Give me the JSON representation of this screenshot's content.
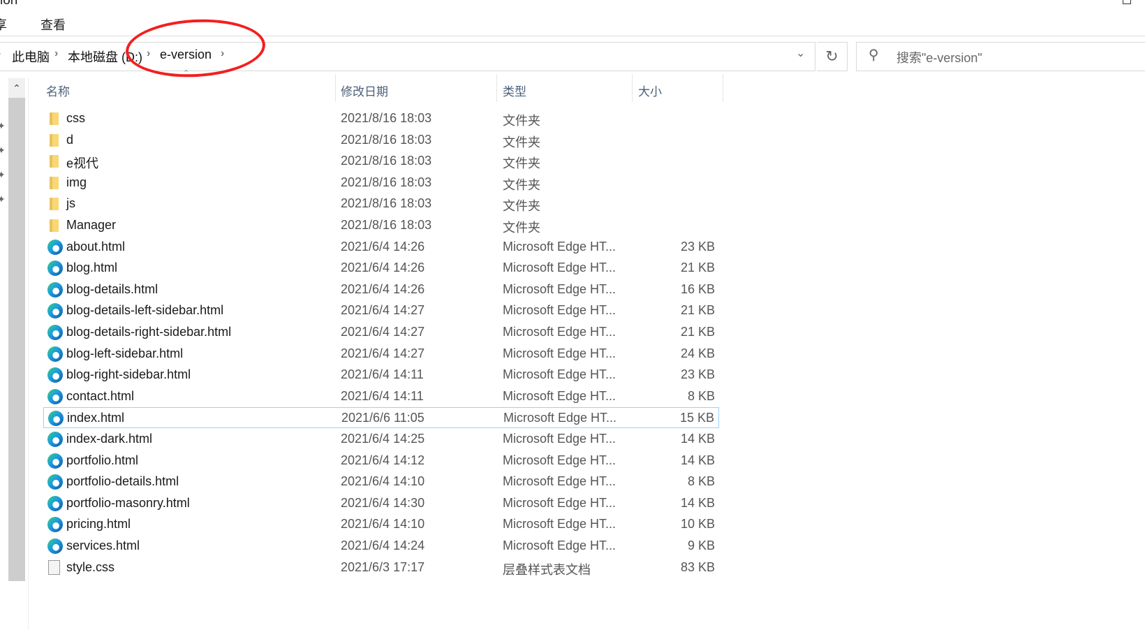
{
  "window": {
    "title_fragment": "ion"
  },
  "ribbon": {
    "tabs": [
      "享",
      "查看"
    ]
  },
  "address": {
    "crumbs": [
      "此电脑",
      "本地磁盘 (D:)",
      "e-version"
    ]
  },
  "search": {
    "placeholder": "搜索\"e-version\""
  },
  "icons": {
    "refresh": "↻",
    "dropdown": "⌄",
    "search": "⚲",
    "scroll_up": "⌃",
    "sort": "⌃"
  },
  "columns": {
    "name": "名称",
    "date": "修改日期",
    "type": "类型",
    "size": "大小"
  },
  "colors": {
    "annotation": "#f41e1e",
    "selection_border": "#99d1ff"
  },
  "files": [
    {
      "name": "css",
      "date": "2021/8/16 18:03",
      "type": "文件夹",
      "size": "",
      "icon": "folder"
    },
    {
      "name": "d",
      "date": "2021/8/16 18:03",
      "type": "文件夹",
      "size": "",
      "icon": "folder"
    },
    {
      "name": "e视代",
      "date": "2021/8/16 18:03",
      "type": "文件夹",
      "size": "",
      "icon": "folder"
    },
    {
      "name": "img",
      "date": "2021/8/16 18:03",
      "type": "文件夹",
      "size": "",
      "icon": "folder"
    },
    {
      "name": "js",
      "date": "2021/8/16 18:03",
      "type": "文件夹",
      "size": "",
      "icon": "folder"
    },
    {
      "name": "Manager",
      "date": "2021/8/16 18:03",
      "type": "文件夹",
      "size": "",
      "icon": "folder"
    },
    {
      "name": "about.html",
      "date": "2021/6/4 14:26",
      "type": "Microsoft Edge HT...",
      "size": "23 KB",
      "icon": "edge"
    },
    {
      "name": "blog.html",
      "date": "2021/6/4 14:26",
      "type": "Microsoft Edge HT...",
      "size": "21 KB",
      "icon": "edge"
    },
    {
      "name": "blog-details.html",
      "date": "2021/6/4 14:26",
      "type": "Microsoft Edge HT...",
      "size": "16 KB",
      "icon": "edge"
    },
    {
      "name": "blog-details-left-sidebar.html",
      "date": "2021/6/4 14:27",
      "type": "Microsoft Edge HT...",
      "size": "21 KB",
      "icon": "edge"
    },
    {
      "name": "blog-details-right-sidebar.html",
      "date": "2021/6/4 14:27",
      "type": "Microsoft Edge HT...",
      "size": "21 KB",
      "icon": "edge"
    },
    {
      "name": "blog-left-sidebar.html",
      "date": "2021/6/4 14:27",
      "type": "Microsoft Edge HT...",
      "size": "24 KB",
      "icon": "edge"
    },
    {
      "name": "blog-right-sidebar.html",
      "date": "2021/6/4 14:11",
      "type": "Microsoft Edge HT...",
      "size": "23 KB",
      "icon": "edge"
    },
    {
      "name": "contact.html",
      "date": "2021/6/4 14:11",
      "type": "Microsoft Edge HT...",
      "size": "8 KB",
      "icon": "edge"
    },
    {
      "name": "index.html",
      "date": "2021/6/6 11:05",
      "type": "Microsoft Edge HT...",
      "size": "15 KB",
      "icon": "edge",
      "selected": true
    },
    {
      "name": "index-dark.html",
      "date": "2021/6/4 14:25",
      "type": "Microsoft Edge HT...",
      "size": "14 KB",
      "icon": "edge"
    },
    {
      "name": "portfolio.html",
      "date": "2021/6/4 14:12",
      "type": "Microsoft Edge HT...",
      "size": "14 KB",
      "icon": "edge"
    },
    {
      "name": "portfolio-details.html",
      "date": "2021/6/4 14:10",
      "type": "Microsoft Edge HT...",
      "size": "8 KB",
      "icon": "edge"
    },
    {
      "name": "portfolio-masonry.html",
      "date": "2021/6/4 14:30",
      "type": "Microsoft Edge HT...",
      "size": "14 KB",
      "icon": "edge"
    },
    {
      "name": "pricing.html",
      "date": "2021/6/4 14:10",
      "type": "Microsoft Edge HT...",
      "size": "10 KB",
      "icon": "edge"
    },
    {
      "name": "services.html",
      "date": "2021/6/4 14:24",
      "type": "Microsoft Edge HT...",
      "size": "9 KB",
      "icon": "edge"
    },
    {
      "name": "style.css",
      "date": "2021/6/3 17:17",
      "type": "层叠样式表文档",
      "size": "83 KB",
      "icon": "css"
    }
  ]
}
